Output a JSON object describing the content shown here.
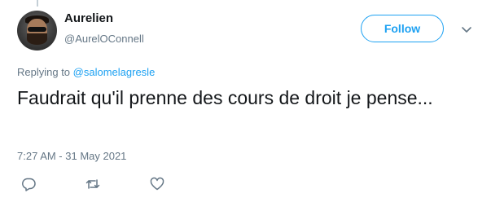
{
  "tweet": {
    "display_name": "Aurelien",
    "handle": "@AurelOConnell",
    "follow_label": "Follow",
    "replying_prefix": "Replying to",
    "replying_to": "@salomelagresle",
    "text": "Faudrait qu'il prenne des cours de droit je pense...",
    "timestamp": "7:27 AM - 31 May 2021"
  },
  "icons": {
    "caret": "chevron-down-icon",
    "reply": "reply-icon",
    "retweet": "retweet-icon",
    "like": "heart-icon"
  },
  "colors": {
    "accent": "#1da1f2",
    "text": "#14171a",
    "secondary": "#657786",
    "icon": "#657786"
  }
}
